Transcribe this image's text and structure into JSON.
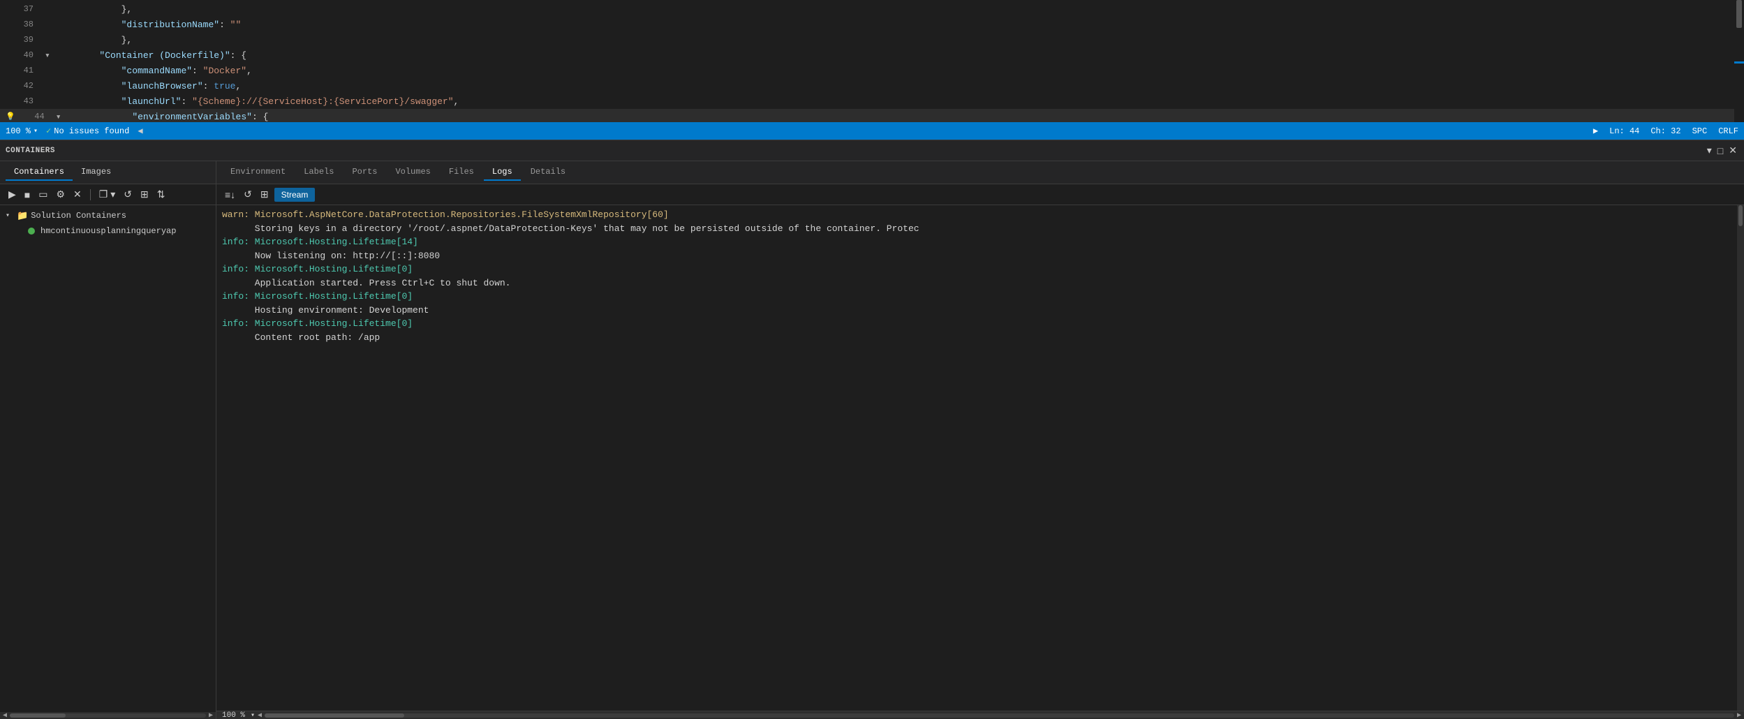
{
  "editor": {
    "lines": [
      {
        "num": "37",
        "indent": 3,
        "content": "},",
        "chevron": "",
        "colors": "punc"
      },
      {
        "num": "38",
        "indent": 3,
        "content": "\"distributionName\": \"\"",
        "chevron": "",
        "colors": "key-str"
      },
      {
        "num": "39",
        "indent": 3,
        "content": "},",
        "chevron": "",
        "colors": "punc"
      },
      {
        "num": "40",
        "indent": 2,
        "content": "\"Container (Dockerfile)\": {",
        "chevron": "▾",
        "colors": "key"
      },
      {
        "num": "41",
        "indent": 3,
        "content": "\"commandName\": \"Docker\",",
        "chevron": "",
        "colors": "key-str"
      },
      {
        "num": "42",
        "indent": 3,
        "content": "\"launchBrowser\": true,",
        "chevron": "",
        "colors": "key-bool"
      },
      {
        "num": "43",
        "indent": 3,
        "content": "\"launchUrl\": \"{Scheme}://{ServiceHost}:{ServicePort}/swagger\",",
        "chevron": "",
        "colors": "key-str"
      },
      {
        "num": "44",
        "indent": 3,
        "content": "\"environmentVariables\": {",
        "chevron": "▾",
        "colors": "key",
        "lightbulb": true
      }
    ]
  },
  "statusbar": {
    "zoom": "100 %",
    "no_issues": "No issues found",
    "ln": "Ln: 44",
    "ch": "Ch: 32",
    "spc": "SPC",
    "crlf": "CRLF"
  },
  "panel": {
    "title": "Containers",
    "tabs": {
      "left": [
        "Containers",
        "Images"
      ],
      "right": [
        "Environment",
        "Labels",
        "Ports",
        "Volumes",
        "Files",
        "Logs",
        "Details"
      ]
    },
    "active_left_tab": "Containers",
    "active_right_tab": "Logs"
  },
  "toolbar_left": {
    "buttons": [
      "▶",
      "■",
      "□",
      "⚙",
      "✕",
      "❐▾",
      "↺",
      "❐",
      "⇅"
    ]
  },
  "toolbar_right": {
    "buttons": [
      "≡↓",
      "↺",
      "⊞"
    ],
    "stream_label": "Stream"
  },
  "tree": {
    "items": [
      {
        "label": "Solution Containers",
        "indent": 0,
        "icon": "folder",
        "expand": "▾"
      },
      {
        "label": "hmcontinuousplanningqueryap",
        "indent": 1,
        "icon": "container",
        "running": true
      }
    ]
  },
  "logs": {
    "lines": [
      {
        "type": "warn",
        "text": "warn: Microsoft.AspNetCore.DataProtection.Repositories.FileSystemXmlRepository[60]"
      },
      {
        "type": "text",
        "text": "      Storing keys in a directory '/root/.aspnet/DataProtection-Keys' that may not be persisted outside of the container. Protec"
      },
      {
        "type": "info",
        "text": "info: Microsoft.Hosting.Lifetime[14]"
      },
      {
        "type": "text",
        "text": "      Now listening on: http://[::]:8080"
      },
      {
        "type": "info",
        "text": "info: Microsoft.Hosting.Lifetime[0]"
      },
      {
        "type": "text",
        "text": "      Application started. Press Ctrl+C to shut down."
      },
      {
        "type": "info",
        "text": "info: Microsoft.Hosting.Lifetime[0]"
      },
      {
        "type": "text",
        "text": "      Hosting environment: Development"
      },
      {
        "type": "info",
        "text": "info: Microsoft.Hosting.Lifetime[0]"
      },
      {
        "type": "text",
        "text": "      Content root path: /app"
      }
    ]
  },
  "bottom_scrollbar": {
    "zoom_label": "100 %"
  }
}
